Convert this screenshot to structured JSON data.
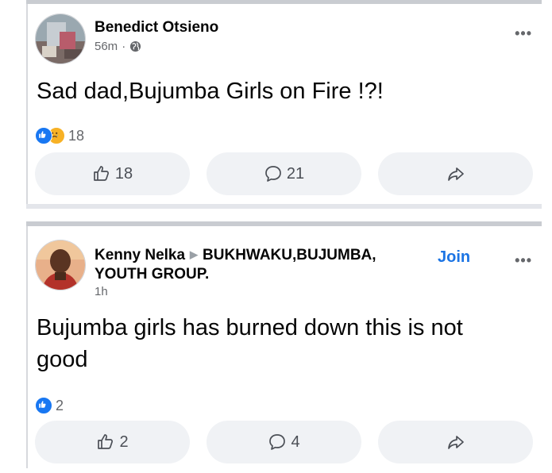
{
  "posts": [
    {
      "author": "Benedict Otsieno",
      "time": "56m",
      "separator": "·",
      "text": "Sad dad,Bujumba Girls on Fire !?!",
      "reaction_count": "18",
      "like_count": "18",
      "comment_count": "21",
      "more": "•••"
    },
    {
      "author": "Kenny Nelka",
      "group_line1": "BUKHWAKU,BUJUMBA,",
      "group_line2": "YOUTH GROUP.",
      "join": "Join",
      "time": "1h",
      "text_line1": "Bujumba girls has burned down this is not",
      "text_line2": "good",
      "reaction_count": "2",
      "like_count": "2",
      "comment_count": "4",
      "more": "•••"
    }
  ],
  "colors": {
    "accent": "#1b74e4",
    "like": "#1877f2",
    "sad": "#f7b125",
    "button_bg": "#f0f2f5"
  },
  "icons": [
    "globe-icon",
    "like-icon",
    "comment-icon",
    "share-icon",
    "more-icon"
  ]
}
